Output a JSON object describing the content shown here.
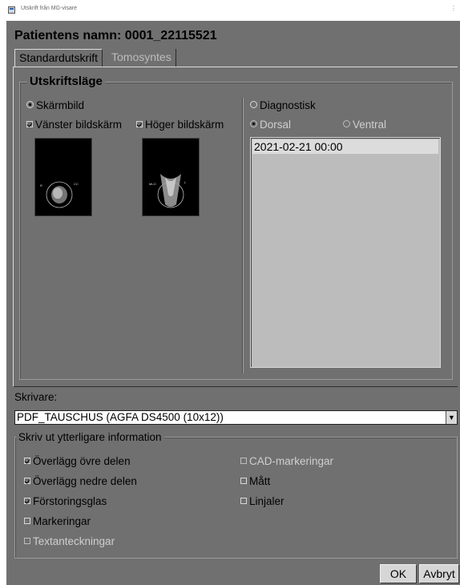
{
  "window": {
    "title": "Utskrift från MG-visare"
  },
  "patient": {
    "label": "Patientens namn: 0001_22115521"
  },
  "tabs": [
    {
      "label": "Standardutskrift"
    },
    {
      "label": "Tomosyntes"
    }
  ],
  "print_mode": {
    "label": "Utskriftsläge",
    "screen_option": {
      "label": "Skärmbild",
      "selected": true
    },
    "left_screen": {
      "label": "Vänster bildskärm",
      "checked": true
    },
    "right_screen": {
      "label": "Höger bildskärm",
      "checked": true
    },
    "diagnostic_option": {
      "label": "Diagnostisk",
      "selected": false
    },
    "dorsal": {
      "label": "Dorsal",
      "selected": true
    },
    "ventral": {
      "label": "Ventral",
      "selected": false
    },
    "exams": [
      "2021-02-21 00:00"
    ]
  },
  "printer": {
    "label": "Skrivare:",
    "selected": "PDF_TAUSCHUS (AGFA DS4500 (10x12))"
  },
  "extra_info": {
    "label": "Skriv ut ytterligare information",
    "overlay_top": {
      "label": "Överlägg övre delen",
      "checked": true
    },
    "overlay_bottom": {
      "label": "Överlägg nedre delen",
      "checked": true
    },
    "magnifier": {
      "label": "Förstoringsglas",
      "checked": true
    },
    "markings": {
      "label": "Markeringar",
      "checked": false
    },
    "text_annotations": {
      "label": "Textanteckningar",
      "checked": false
    },
    "cad_markings": {
      "label": "CAD-markeringar",
      "checked": false
    },
    "measurements": {
      "label": "Mått",
      "checked": false
    },
    "rulers": {
      "label": "Linjaler",
      "checked": false
    }
  },
  "buttons": {
    "ok": "OK",
    "cancel": "Avbryt"
  },
  "colors": {
    "dialog_bg": "#707070",
    "list_bg": "#bcbcbc",
    "selected_row": "#dcdcdc"
  }
}
